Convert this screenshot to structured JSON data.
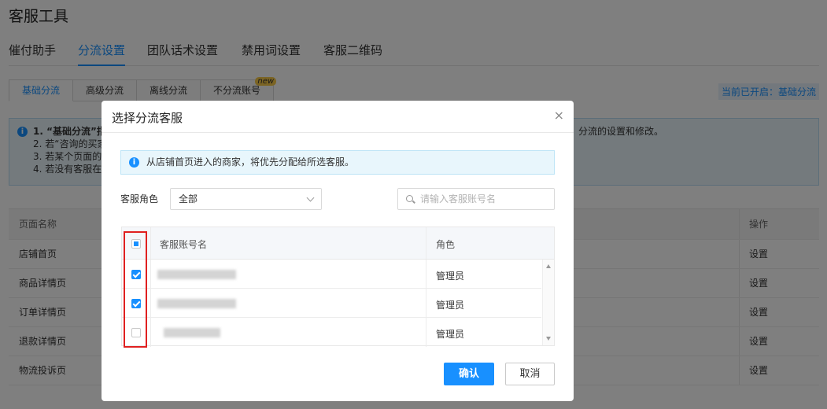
{
  "page": {
    "title": "客服工具",
    "main_tabs": [
      "催付助手",
      "分流设置",
      "团队话术设置",
      "禁用词设置",
      "客服二维码"
    ],
    "sub_tabs": [
      "基础分流",
      "高级分流",
      "离线分流",
      "不分流账号"
    ],
    "new_badge": "new",
    "current_status": "当前已开启：基础分流",
    "info_lines": [
      "1. “基础分流”指",
      "2. 若“咨询的买家",
      "3. 若某个页面的",
      "4. 若没有客服在"
    ],
    "info_tail": "分流的设置和修改。",
    "table_headers": {
      "name": "页面名称",
      "op": "操作"
    },
    "table_rows": [
      {
        "name": "店铺首页",
        "op": "设置"
      },
      {
        "name": "商品详情页",
        "op": "设置"
      },
      {
        "name": "订单详情页",
        "op": "设置"
      },
      {
        "name": "退款详情页",
        "op": "设置"
      },
      {
        "name": "物流投诉页",
        "op": "设置"
      }
    ]
  },
  "modal": {
    "title": "选择分流客服",
    "close_glyph": "×",
    "tip": "从店铺首页进入的商家，将优先分配给所选客服。",
    "role_label": "客服角色",
    "role_value": "全部",
    "search_placeholder": "请输入客服账号名",
    "columns": {
      "account": "客服账号名",
      "role": "角色"
    },
    "rows": [
      {
        "role": "管理员",
        "checked": true
      },
      {
        "role": "管理员",
        "checked": true
      },
      {
        "role": "管理员",
        "checked": false
      }
    ],
    "confirm_label": "确认",
    "cancel_label": "取消"
  },
  "colors": {
    "accent": "#1890ff",
    "highlight": "#e02020"
  }
}
